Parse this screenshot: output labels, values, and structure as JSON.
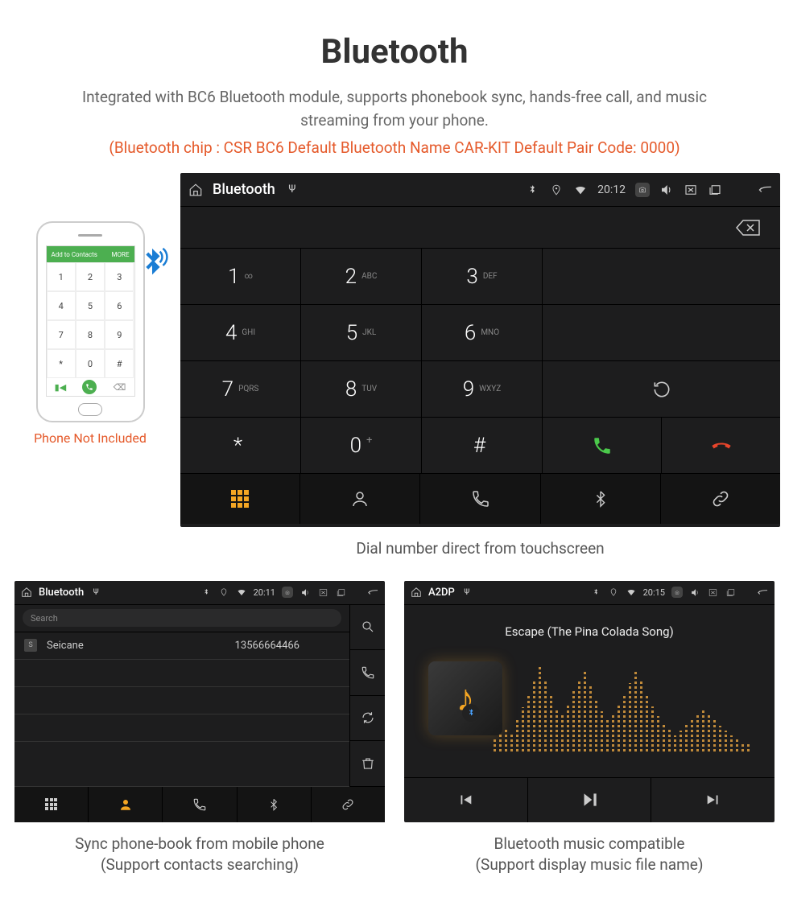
{
  "title": "Bluetooth",
  "intro": "Integrated with BC6 Bluetooth module, supports phonebook sync, hands-free call, and music streaming from your phone.",
  "specs": "(Bluetooth chip : CSR BC6    Default Bluetooth Name CAR-KIT    Default Pair Code: 0000)",
  "phone": {
    "top_label": "Add to Contacts",
    "top_more": "MORE",
    "keys": [
      "1",
      "2",
      "3",
      "4",
      "5",
      "6",
      "7",
      "8",
      "9",
      "*",
      "0",
      "#"
    ],
    "caption": "Phone Not Included"
  },
  "dialer": {
    "status": {
      "title": "Bluetooth",
      "time": "20:12"
    },
    "keys": [
      {
        "num": "1",
        "sub": "∞"
      },
      {
        "num": "2",
        "sub": "ABC"
      },
      {
        "num": "3",
        "sub": "DEF"
      },
      {
        "num": "4",
        "sub": "GHI"
      },
      {
        "num": "5",
        "sub": "JKL"
      },
      {
        "num": "6",
        "sub": "MNO"
      },
      {
        "num": "7",
        "sub": "PQRS"
      },
      {
        "num": "8",
        "sub": "TUV"
      },
      {
        "num": "9",
        "sub": "WXYZ"
      },
      {
        "num": "*",
        "sub": ""
      },
      {
        "num": "0",
        "sub": "+"
      },
      {
        "num": "#",
        "sub": ""
      }
    ],
    "caption": "Dial number direct from touchscreen"
  },
  "phonebook": {
    "status": {
      "title": "Bluetooth",
      "time": "20:11"
    },
    "search_placeholder": "Search",
    "contact": {
      "letter": "S",
      "name": "Seicane",
      "number": "13566664466"
    },
    "caption_l1": "Sync phone-book from mobile phone",
    "caption_l2": "(Support contacts searching)"
  },
  "music": {
    "status": {
      "title": "A2DP",
      "time": "20:15"
    },
    "track": "Escape (The Pina Colada Song)",
    "caption_l1": "Bluetooth music compatible",
    "caption_l2": "(Support display music file name)"
  }
}
